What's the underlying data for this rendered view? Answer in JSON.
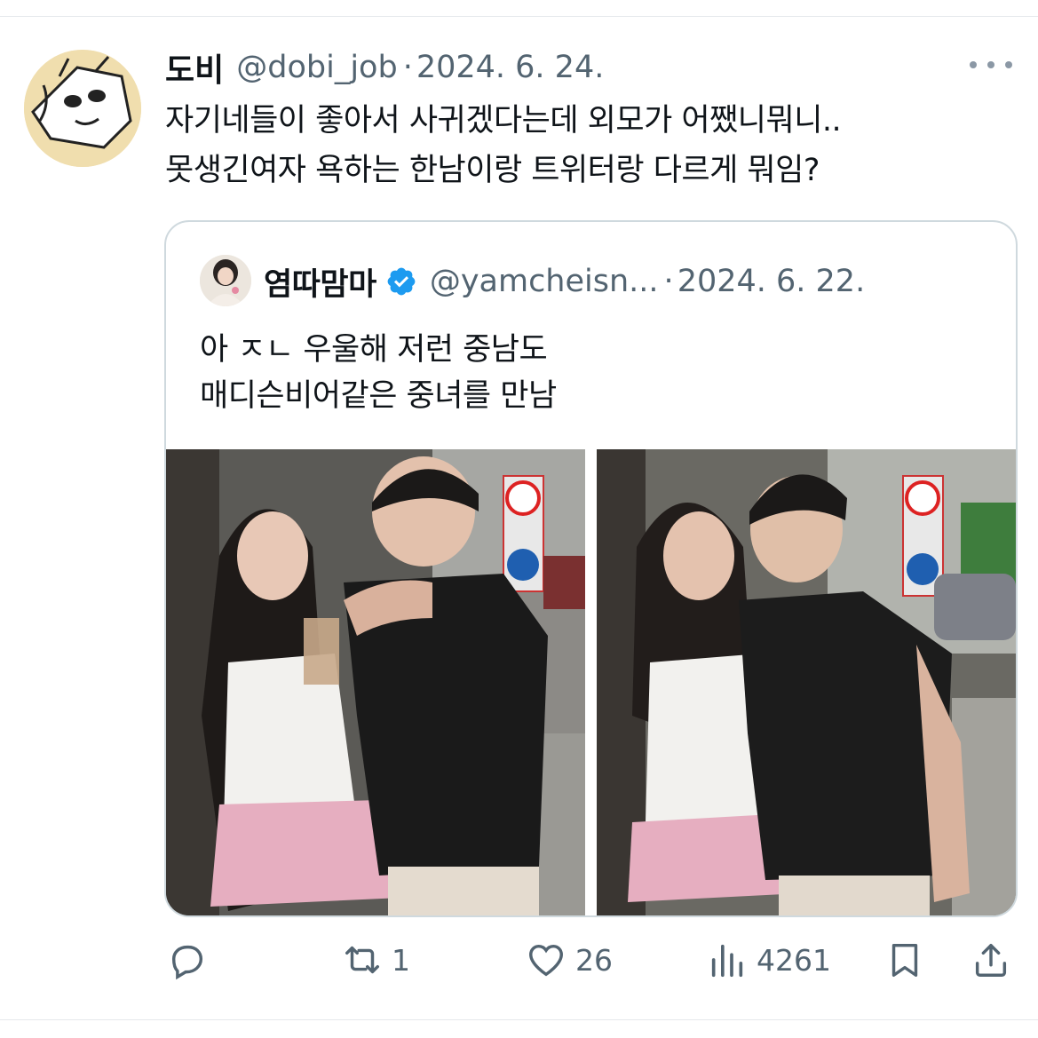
{
  "colors": {
    "text": "#0f1419",
    "muted": "#536471",
    "verified": "#1d9bf0",
    "border": "#cfd9de"
  },
  "tweet": {
    "author_name": "도비",
    "author_handle": "@dobi_job",
    "separator": "·",
    "date": "2024. 6. 24.",
    "text_lines": [
      "자기네들이 좋아서 사귀겠다는데 외모가 어쨌니뭐니..",
      "못생긴여자 욕하는 한남이랑 트위터랑 다르게 뭐임?"
    ],
    "more_icon": "more-horizontal-icon"
  },
  "quote": {
    "author_name": "염따맘마",
    "verified_icon": "verified-badge-icon",
    "author_handle": "@yamcheisn...",
    "separator": "·",
    "date": "2024. 6. 22.",
    "text_lines": [
      "아 ㅈㄴ 우울해 저런 중남도",
      "매디슨비어같은 중녀를 만남"
    ],
    "photos": [
      "couple-photo-straw",
      "couple-photo-posing"
    ]
  },
  "actions": {
    "reply": {
      "icon": "reply-icon",
      "count": ""
    },
    "retweet": {
      "icon": "retweet-icon",
      "count": "1"
    },
    "like": {
      "icon": "heart-icon",
      "count": "26"
    },
    "views": {
      "icon": "views-chart-icon",
      "count": "4261"
    },
    "bookmark": {
      "icon": "bookmark-icon"
    },
    "share": {
      "icon": "share-icon"
    }
  }
}
